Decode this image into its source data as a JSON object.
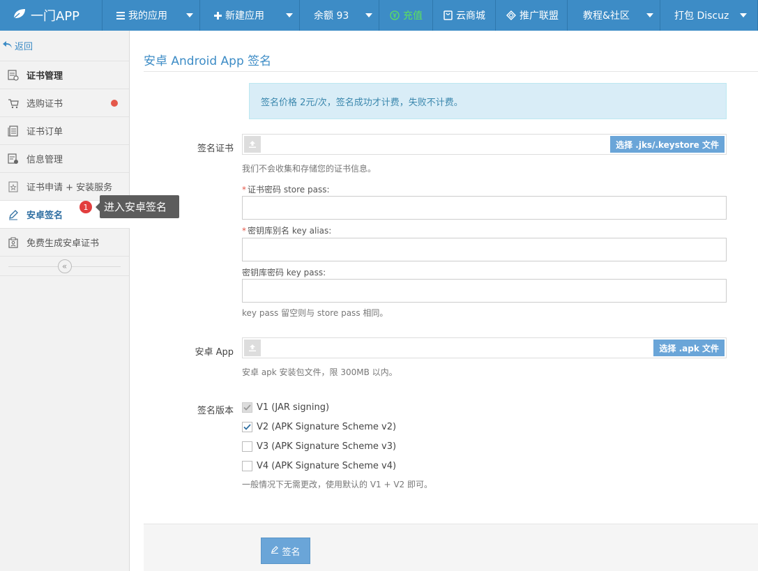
{
  "topbar": {
    "brand": "一门APP",
    "items": [
      {
        "label": "我的应用",
        "icon": "list-icon"
      },
      {
        "label": "新建应用",
        "icon": "plus-icon"
      },
      {
        "label": "余额 93",
        "icon": ""
      },
      {
        "label": "充值",
        "icon": "yen-icon"
      },
      {
        "label": "云商城",
        "icon": "shop-icon"
      },
      {
        "label": "推广联盟",
        "icon": "diamond-icon"
      },
      {
        "label": "教程&社区",
        "icon": ""
      },
      {
        "label": "打包 Discuz",
        "icon": ""
      }
    ]
  },
  "sidebar": {
    "back_label": "返回",
    "items": [
      {
        "label": "证书管理"
      },
      {
        "label": "选购证书"
      },
      {
        "label": "证书订单"
      },
      {
        "label": "信息管理"
      },
      {
        "label": "证书申请 + 安装服务"
      },
      {
        "label": "安卓签名"
      },
      {
        "label": "免费生成安卓证书"
      }
    ],
    "collapse_glyph": "«"
  },
  "tooltip": {
    "badge": "1",
    "text": "进入安卓签名"
  },
  "main": {
    "title": "安卓 Android App 签名",
    "notice": "签名价格 2元/次，签名成功才计费，失败不计费。",
    "cert": {
      "label": "签名证书",
      "button": "选择 .jks/.keystore 文件",
      "help": "我们不会收集和存储您的证书信息。"
    },
    "store_pass": {
      "req": "*",
      "label": "证书密码 store pass:",
      "value": ""
    },
    "key_alias": {
      "req": "*",
      "label": "密钥库别名 key alias:",
      "value": ""
    },
    "key_pass": {
      "label": "密钥库密码 key pass:",
      "value": "",
      "help": "key pass 留空则与 store pass 相同。"
    },
    "app": {
      "label": "安卓 App",
      "button": "选择 .apk 文件",
      "help": "安卓 apk 安装包文件，限 300MB 以内。"
    },
    "version": {
      "label": "签名版本",
      "options": [
        {
          "label": "V1 (JAR signing)",
          "checked": true,
          "disabled": true
        },
        {
          "label": "V2 (APK Signature Scheme v2)",
          "checked": true,
          "disabled": false
        },
        {
          "label": "V3 (APK Signature Scheme v3)",
          "checked": false,
          "disabled": false
        },
        {
          "label": "V4 (APK Signature Scheme v4)",
          "checked": false,
          "disabled": false
        }
      ],
      "help": "一般情况下无需更改，使用默认的 V1 + V2 即可。"
    },
    "submit_label": "签名"
  }
}
